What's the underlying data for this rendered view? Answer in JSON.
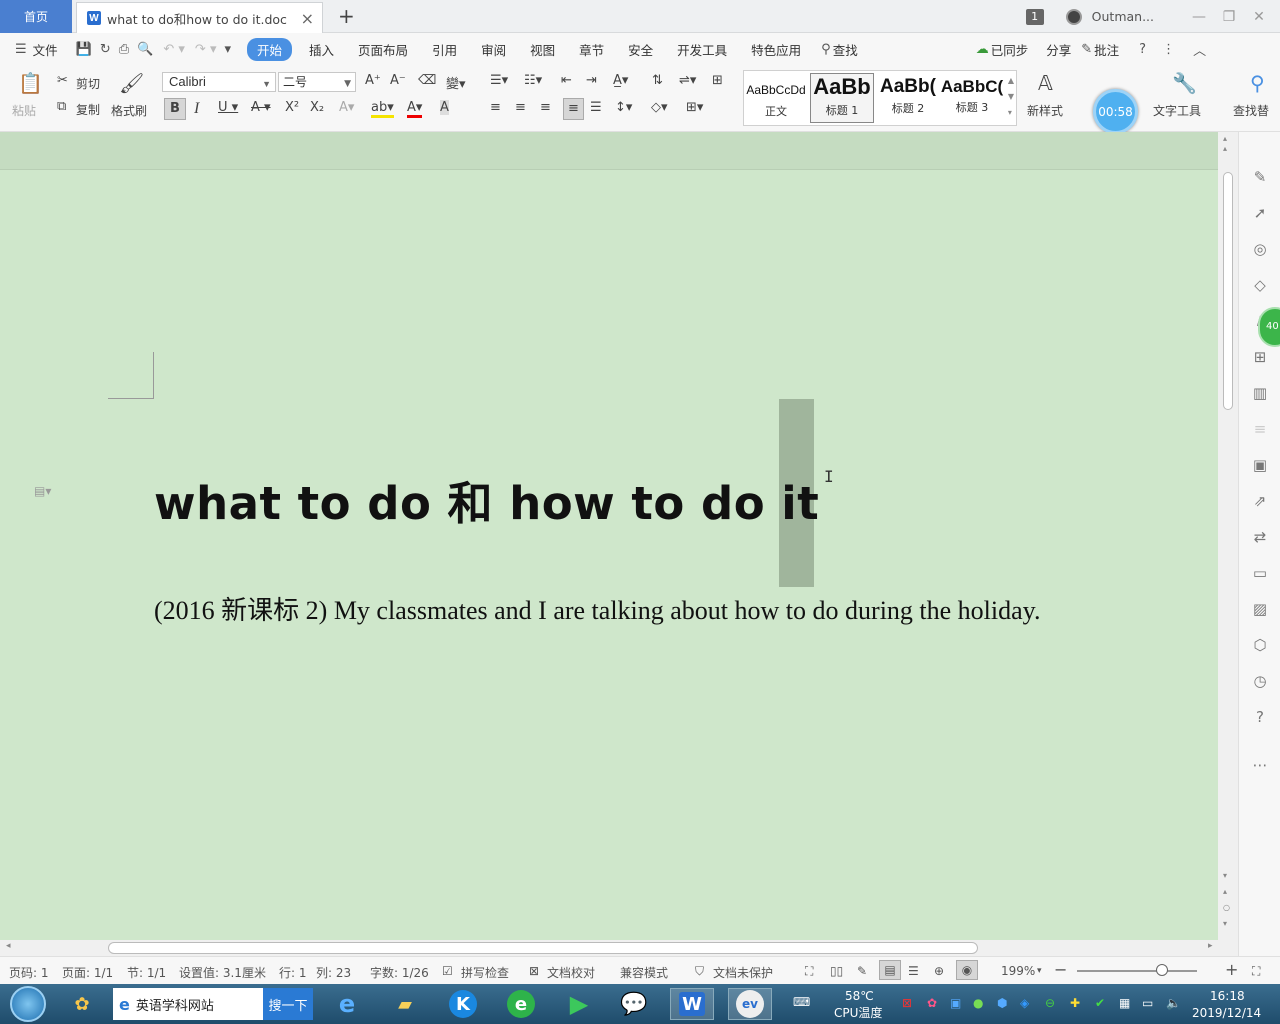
{
  "titlebar": {
    "home_tab": "首页",
    "doc_tab": "what to do和how to do it.doc",
    "doc_icon": "W",
    "badge": "1",
    "username": "Outman..."
  },
  "menu": {
    "file": "文件",
    "items": [
      "开始",
      "插入",
      "页面布局",
      "引用",
      "审阅",
      "视图",
      "章节",
      "安全",
      "开发工具",
      "特色应用"
    ],
    "search": "查找",
    "sync": "已同步",
    "share": "分享",
    "comment": "批注"
  },
  "ribbon": {
    "paste": "粘贴",
    "cut": "剪切",
    "copy": "复制",
    "format_painter": "格式刷",
    "font_name": "Calibri",
    "font_size": "二号",
    "styles": [
      {
        "sample": "AaBbCcDd",
        "label": "正文"
      },
      {
        "sample": "AaBb",
        "label": "标题 1"
      },
      {
        "sample": "AaBb(",
        "label": "标题 2"
      },
      {
        "sample": "AaBbC(",
        "label": "标题 3"
      }
    ],
    "new_style": "新样式",
    "text_tools": "文字工具",
    "find_replace": "查找替",
    "timer": "00:58"
  },
  "document": {
    "title": "what to do  和 how to do it",
    "paragraph": "(2016 新课标 2) My classmates and I are talking about how to do during the holiday."
  },
  "side_badge": "40",
  "statusbar": {
    "page_code": "页码: 1",
    "page": "页面: 1/1",
    "section": "节: 1/1",
    "setting": "设置值: 3.1厘米",
    "row": "行: 1",
    "col": "列: 23",
    "wordcount": "字数: 1/26",
    "spell": "拼写检查",
    "proof": "文档校对",
    "compat": "兼容模式",
    "protect": "文档未保护",
    "zoom": "199%"
  },
  "taskbar": {
    "search_text": "英语学科网站",
    "search_button": "搜一下",
    "temp": "58℃",
    "cpu": "CPU温度",
    "time": "16:18",
    "date": "2019/12/14"
  }
}
